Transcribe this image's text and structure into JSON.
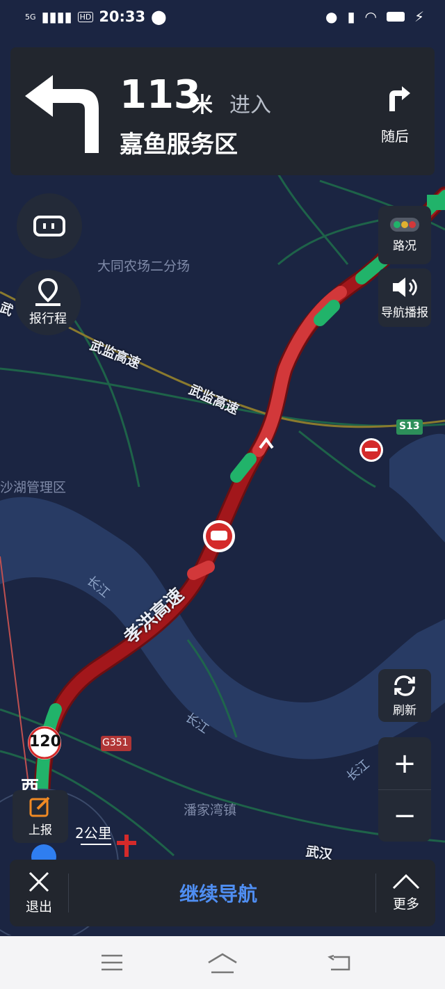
{
  "status_bar": {
    "network": "5G",
    "hd": "HD",
    "time": "20:33"
  },
  "nav": {
    "distance": "113",
    "unit": "米",
    "action": "进入",
    "road": "嘉鱼服务区",
    "next_label": "随后"
  },
  "controls": {
    "trip": "报行程",
    "traffic": "路况",
    "voice": "导航播报",
    "refresh": "刷新",
    "zoom_in": "+",
    "zoom_out": "−",
    "report": "上报"
  },
  "map": {
    "place_1": "大同农场二分场",
    "place_2": "沙湖管理区",
    "place_3": "潘家湾镇",
    "road_1": "武监高速",
    "road_2": "武监高速",
    "road_3": "孝洪高速",
    "road_4": "武",
    "road_5": "武汉",
    "river_1": "长江",
    "river_2": "长江",
    "river_3": "长江",
    "shield_s13": "S13",
    "shield_g351": "G351",
    "speed_limit": "120",
    "scale": "2公里",
    "west_marker": "西"
  },
  "bottom": {
    "exit": "退出",
    "continue": "继续导航",
    "more": "更多"
  },
  "colors": {
    "jam": "#a2171b",
    "slow": "#d2383a",
    "clear": "#21b36a",
    "accent": "#4f8ef2"
  }
}
